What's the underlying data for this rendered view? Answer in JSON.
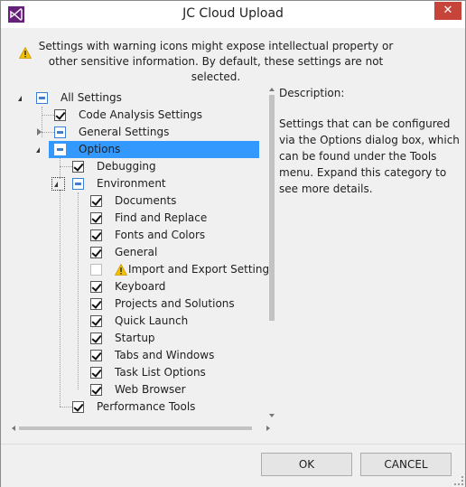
{
  "window": {
    "title": "JC Cloud Upload",
    "close_glyph": "✕",
    "app_icon": "visual-studio-logo-icon"
  },
  "warning": {
    "icon": "warning-icon",
    "text": "Settings with warning icons might expose intellectual property or other sensitive information. By default, these settings are not selected."
  },
  "tree": {
    "all": "All Settings",
    "code_analysis": "Code Analysis Settings",
    "general": "General Settings",
    "options": "Options",
    "debugging": "Debugging",
    "environment": "Environment",
    "env_items": [
      {
        "label": "Documents",
        "checked": true
      },
      {
        "label": "Find and Replace",
        "checked": true
      },
      {
        "label": "Fonts and Colors",
        "checked": true
      },
      {
        "label": "General",
        "checked": true
      },
      {
        "label": "Import and Export Settings",
        "checked": false,
        "warning": true
      },
      {
        "label": "Keyboard",
        "checked": true
      },
      {
        "label": "Projects and Solutions",
        "checked": true
      },
      {
        "label": "Quick Launch",
        "checked": true
      },
      {
        "label": "Startup",
        "checked": true
      },
      {
        "label": "Tabs and Windows",
        "checked": true
      },
      {
        "label": "Task List Options",
        "checked": true
      },
      {
        "label": "Web Browser",
        "checked": true
      }
    ],
    "performance": "Performance Tools"
  },
  "description": {
    "label": "Description:",
    "text": "Settings that can be configured via the Options dialog box, which can be found under the Tools menu. Expand this category to see more details."
  },
  "buttons": {
    "ok": "OK",
    "cancel": "CANCEL"
  },
  "colors": {
    "selection": "#3399ff",
    "close": "#c7443a",
    "partial_check": "#3c7fd4",
    "warning": "#f2c200"
  }
}
